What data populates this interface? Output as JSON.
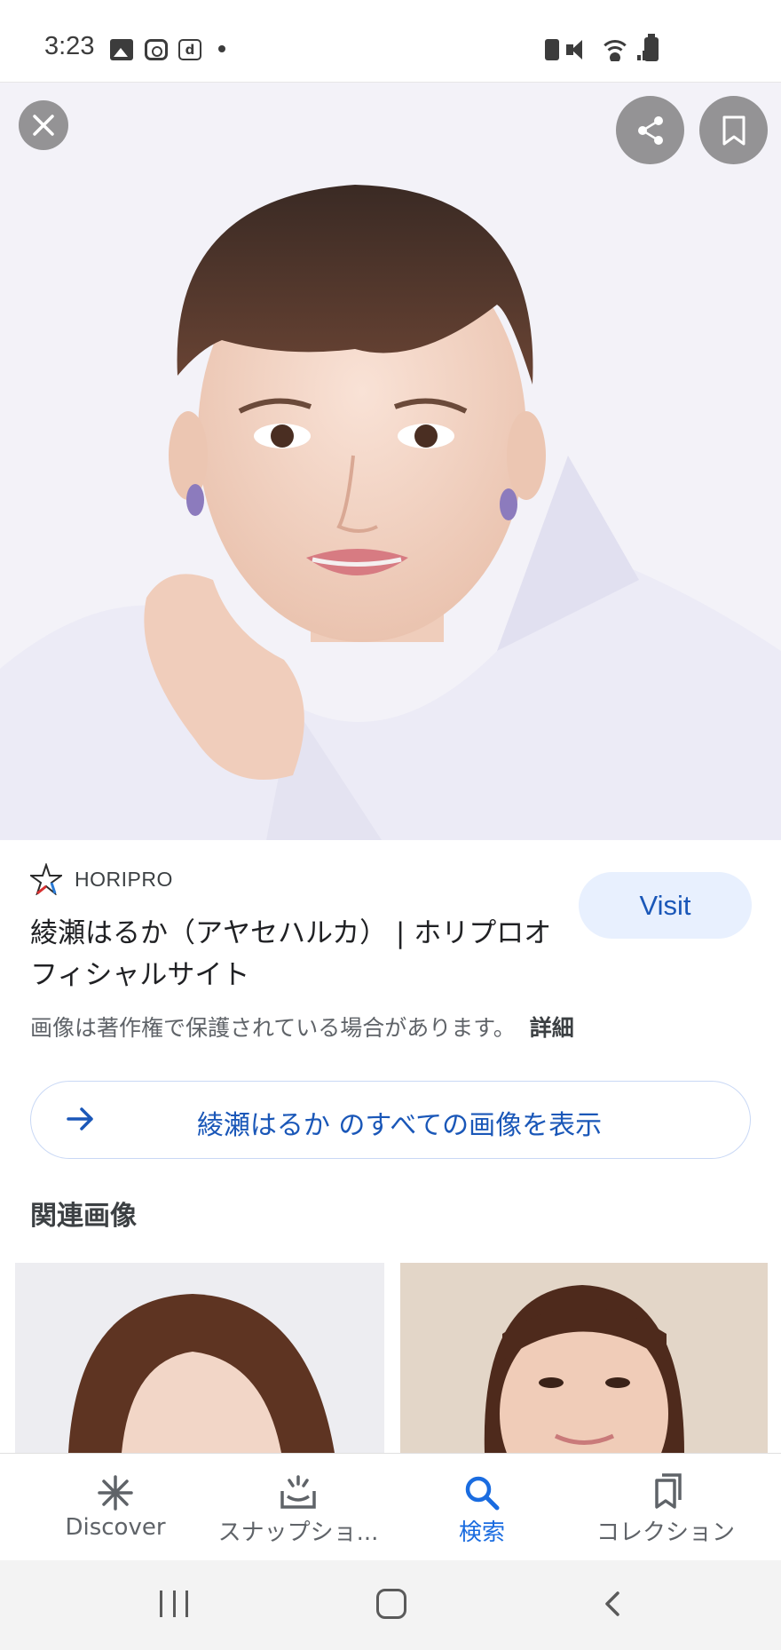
{
  "status_bar": {
    "time": "3:23",
    "left_icons": [
      "gallery-icon",
      "instagram-icon",
      "d-app-icon",
      "notification-dot"
    ],
    "right_icons": [
      "battery-saver-icon",
      "mute-icon",
      "wifi-icon",
      "signal-icon",
      "battery-icon"
    ]
  },
  "viewer": {
    "close_icon": "close-icon",
    "share_icon": "share-icon",
    "save_icon": "bookmark-icon"
  },
  "result": {
    "source_name": "HORIPRO",
    "title": "綾瀬はるか（アヤセハルカ） | ホリプロオフィシャルサイト",
    "visit_label": "Visit",
    "copyright_notice": "画像は著作権で保護されている場合があります。",
    "details_label": "詳細",
    "all_images_label": "綾瀬はるか のすべての画像を表示"
  },
  "related": {
    "heading": "関連画像"
  },
  "bottom_nav": {
    "items": [
      {
        "label": "Discover",
        "icon": "asterisk-icon",
        "active": false
      },
      {
        "label": "スナップショ...",
        "icon": "snapshot-icon",
        "active": false
      },
      {
        "label": "検索",
        "icon": "search-icon",
        "active": true
      },
      {
        "label": "コレクション",
        "icon": "collections-icon",
        "active": false
      }
    ]
  },
  "colors": {
    "accent": "#1a57b8",
    "active_nav": "#1a6ce0",
    "visit_bg": "#e8f0fe",
    "overlay_button": "#787878"
  }
}
